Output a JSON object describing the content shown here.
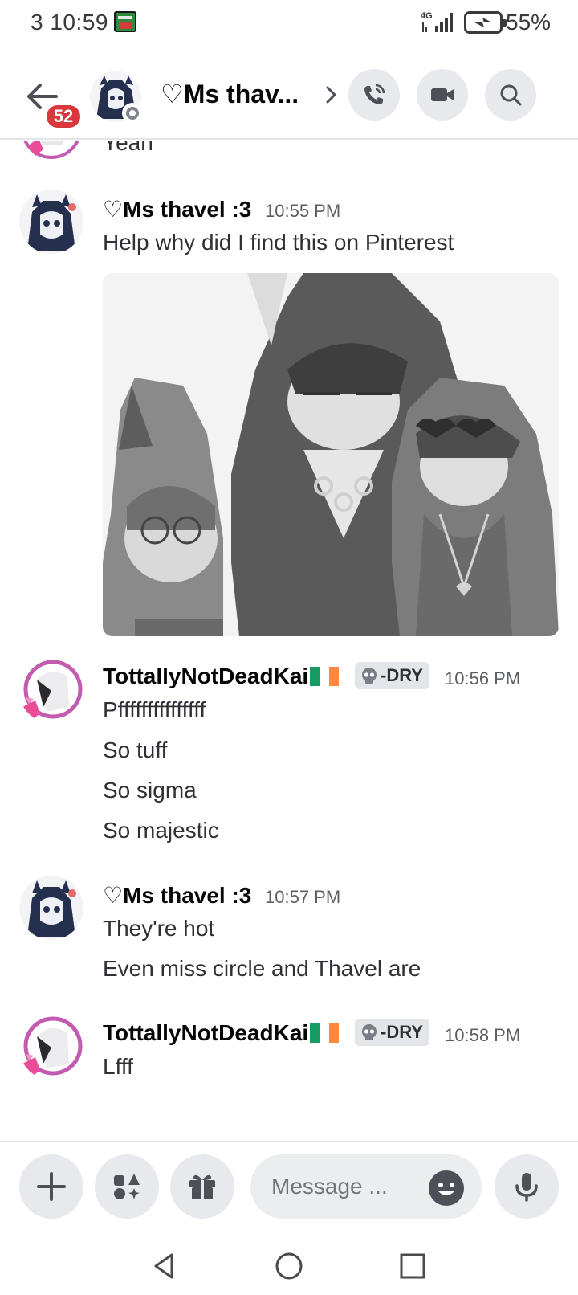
{
  "status_bar": {
    "time": "3 10:59",
    "network_label": "4G",
    "battery_percent": "55%",
    "icons": [
      "game-app-icon",
      "signal-icon",
      "battery-charging-icon"
    ]
  },
  "header": {
    "notification_count": "52",
    "channel_name": "♡Ms thav...",
    "icons": [
      "back-arrow-icon",
      "chevron-right-icon",
      "phone-call-icon",
      "video-camera-icon",
      "search-icon"
    ]
  },
  "messages": [
    {
      "text": "Yeah"
    },
    {
      "author": "♡Ms thavel :3",
      "time": "10:55 PM",
      "lines": [
        "Help why did I find this on Pinterest"
      ],
      "attachment": "image"
    },
    {
      "author": "TottallyNotDeadKai",
      "flag": "ireland-flag",
      "tag": "-DRY",
      "time": "10:56 PM",
      "lines": [
        "Pfffffffffffffff",
        "So tuff",
        "So sigma",
        "So majestic"
      ]
    },
    {
      "author": "♡Ms thavel :3",
      "time": "10:57 PM",
      "lines": [
        "They're  hot",
        "Even miss circle and Thavel are"
      ]
    },
    {
      "author": "TottallyNotDeadKai",
      "flag": "ireland-flag",
      "tag": "-DRY",
      "time": "10:58 PM",
      "lines": [
        "Lfff"
      ]
    }
  ],
  "composer": {
    "placeholder": "Message ...",
    "icons": [
      "plus-icon",
      "apps-icon",
      "gift-icon",
      "emoji-icon",
      "microphone-icon"
    ]
  },
  "navigation": {
    "icons": [
      "nav-back-icon",
      "nav-home-icon",
      "nav-recents-icon"
    ]
  },
  "colors": {
    "badge": "#da373c",
    "timestamp": "#5c5e66",
    "button_bg": "#e8e9ec",
    "flag_green": "#169b62",
    "flag_orange": "#ff883e"
  }
}
